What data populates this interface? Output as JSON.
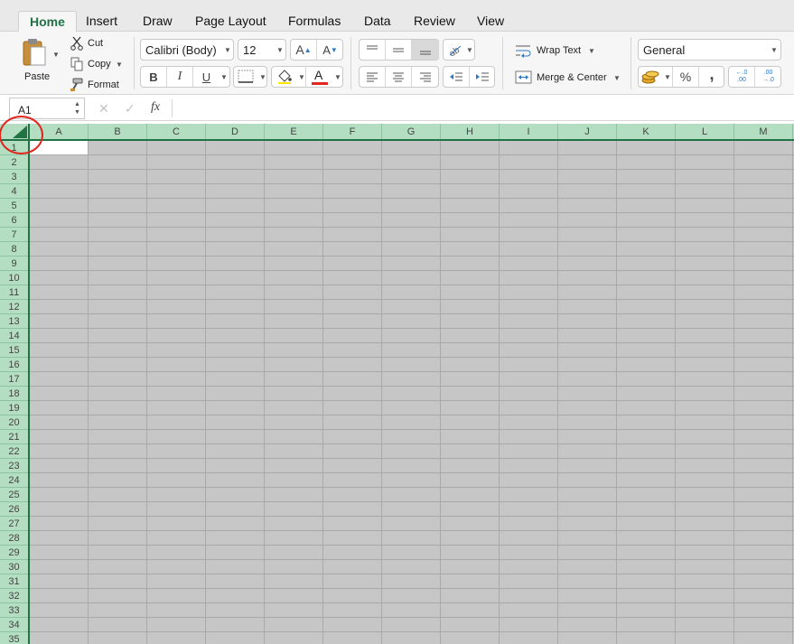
{
  "ribbon_tabs": [
    {
      "label": "Home",
      "active": true
    },
    {
      "label": "Insert",
      "active": false
    },
    {
      "label": "Draw",
      "active": false
    },
    {
      "label": "Page Layout",
      "active": false
    },
    {
      "label": "Formulas",
      "active": false
    },
    {
      "label": "Data",
      "active": false
    },
    {
      "label": "Review",
      "active": false
    },
    {
      "label": "View",
      "active": false
    }
  ],
  "clipboard": {
    "paste_label": "Paste",
    "cut_label": "Cut",
    "copy_label": "Copy",
    "format_label": "Format"
  },
  "font": {
    "family": "Calibri (Body)",
    "size": "12",
    "bold": "B",
    "italic": "I",
    "underline": "U",
    "grow": "A",
    "shrink": "A",
    "color_letter": "A",
    "font_color": "#e0261f"
  },
  "alignment": {
    "wrap_text_label": "Wrap Text",
    "merge_center_label": "Merge & Center"
  },
  "number": {
    "format": "General",
    "percent": "%",
    "comma": ",",
    "increase_decimal": "←.0 .00",
    "decrease_decimal": ".00 →.0"
  },
  "formula_bar": {
    "name_box": "A1",
    "cancel": "✕",
    "enter": "✓",
    "fx": "fx",
    "formula": ""
  },
  "grid": {
    "columns": [
      "A",
      "B",
      "C",
      "D",
      "E",
      "F",
      "G",
      "H",
      "I",
      "J",
      "K",
      "L",
      "M"
    ],
    "rows": [
      "1",
      "2",
      "3",
      "4",
      "5",
      "6",
      "7",
      "8",
      "9",
      "10",
      "11",
      "12",
      "13",
      "14",
      "15",
      "16",
      "17",
      "18",
      "19",
      "20",
      "21",
      "22",
      "23",
      "24",
      "25",
      "26",
      "27",
      "28",
      "29",
      "30",
      "31",
      "32",
      "33",
      "34",
      "35"
    ],
    "active_cell": "A1",
    "selection": "all"
  },
  "colors": {
    "accent": "#217346",
    "header_selected": "#b4dec2",
    "selection_fill": "#c6c6c6",
    "highlight_circle": "#e0261f"
  }
}
